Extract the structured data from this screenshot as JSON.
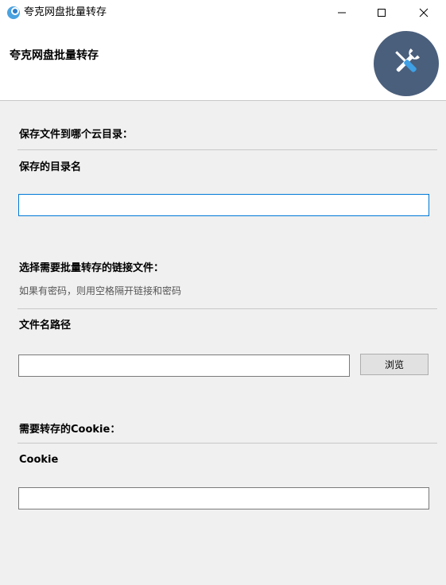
{
  "window": {
    "title": "夸克网盘批量转存",
    "icon": "app-logo-icon",
    "controls": [
      "minimize-icon",
      "maximize-icon",
      "close-icon"
    ]
  },
  "header": {
    "title": "夸克网盘批量转存",
    "logo_icon": "tools-icon",
    "logo_color": "#4a5f7c"
  },
  "section_save_dir": {
    "title": "保存文件到哪个云目录：",
    "field_label": "保存的目录名",
    "input_value": "",
    "input_placeholder": ""
  },
  "section_links": {
    "title": "选择需要批量转存的链接文件：",
    "hint": "如果有密码，则用空格隔开链接和密码",
    "field_label": "文件名路径",
    "input_value": "",
    "browse_label": "浏览"
  },
  "section_cookie": {
    "title": "需要转存的Cookie：",
    "field_label": "Cookie",
    "input_value": ""
  },
  "colors": {
    "focus_border": "#0078d7",
    "background": "#f0f0f0"
  }
}
